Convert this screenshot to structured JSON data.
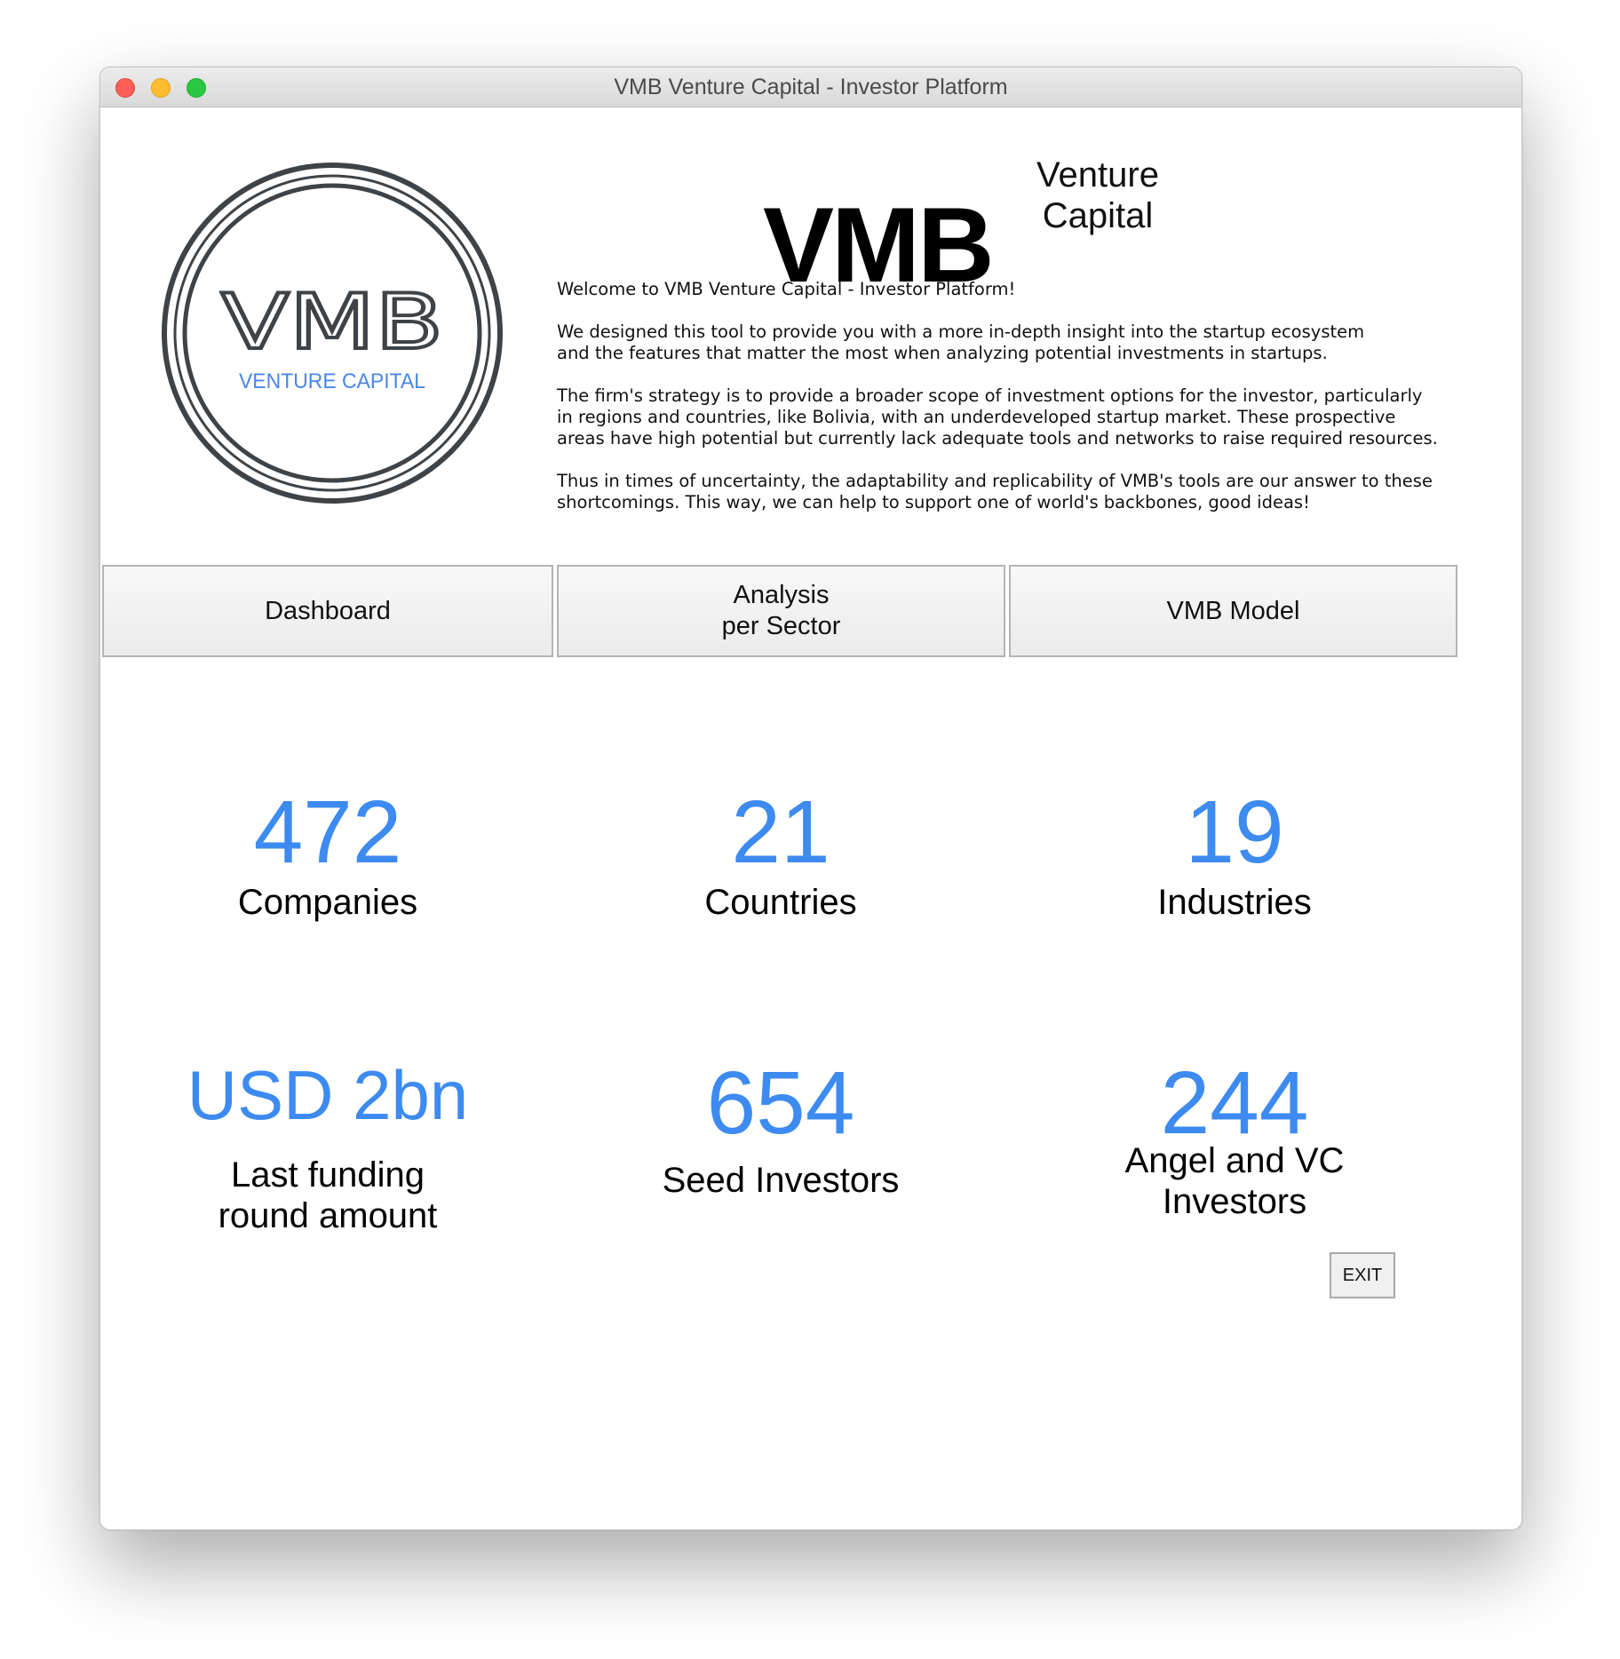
{
  "window": {
    "title": "VMB Venture Capital - Investor Platform"
  },
  "logo": {
    "text": "VMB",
    "subtitle": "VENTURE CAPITAL",
    "ring_color": "#3e4347",
    "subtitle_color": "#4a86e8"
  },
  "header": {
    "brand": "VMB",
    "brand_sub": "Venture\nCapital"
  },
  "intro": {
    "paragraphs": [
      "Welcome to VMB Venture Capital - Investor Platform!",
      "We designed this tool to provide you with a more in-depth insight into the startup ecosystem\nand the features that matter the most when analyzing potential investments in startups.",
      "The firm's strategy is to provide a broader scope of investment options for the investor, particularly\nin regions and countries, like Bolivia, with an underdeveloped startup market. These prospective\nareas have high potential but currently lack adequate tools and networks to raise required resources.",
      "Thus in times of uncertainty, the adaptability and replicability of VMB's tools are our answer to these\nshortcomings. This way, we can help to support one of world's backbones, good ideas!"
    ]
  },
  "nav": {
    "dashboard": "Dashboard",
    "analysis": "Analysis\nper Sector",
    "model": "VMB Model"
  },
  "stats": [
    {
      "value": "472",
      "label": "Companies"
    },
    {
      "value": "21",
      "label": "Countries"
    },
    {
      "value": "19",
      "label": "Industries"
    },
    {
      "value": "USD 2bn",
      "label": "Last funding\nround amount"
    },
    {
      "value": "654",
      "label": "Seed Investors"
    },
    {
      "value": "244",
      "label": "Angel and VC\nInvestors"
    }
  ],
  "exit_label": "EXIT",
  "colors": {
    "accent": "#3d8bf0"
  }
}
